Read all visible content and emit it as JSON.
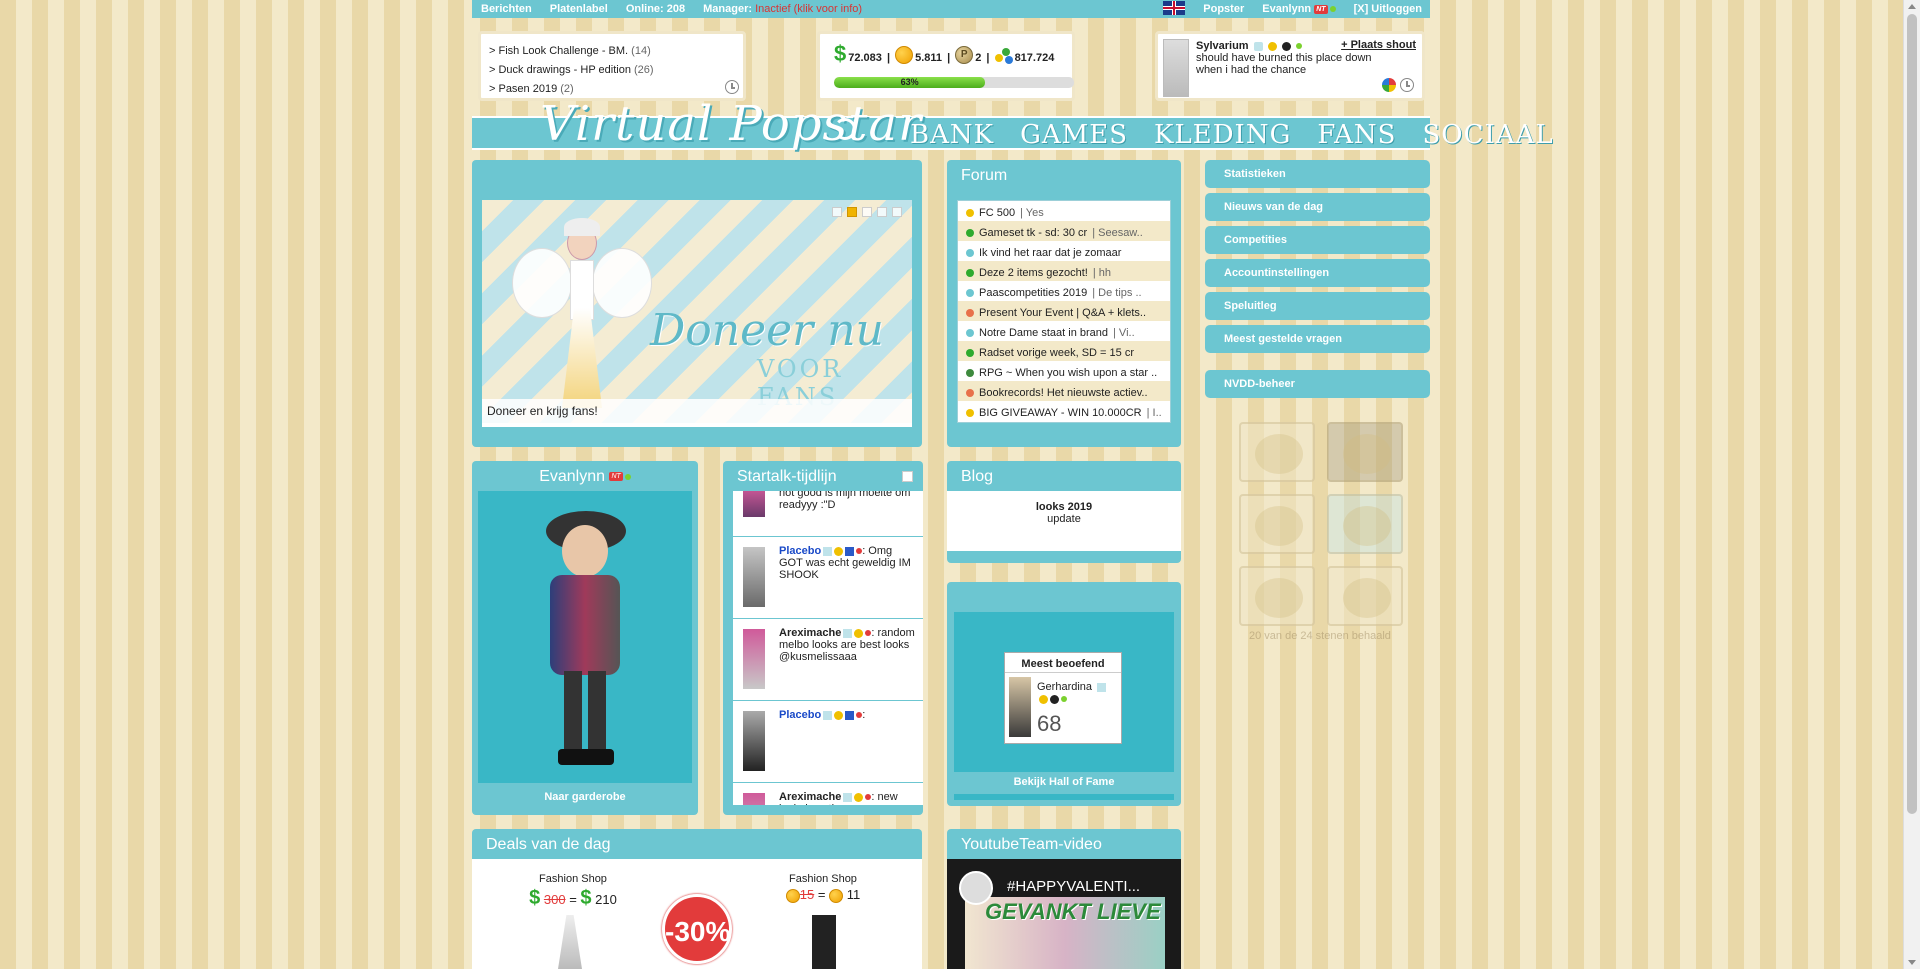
{
  "topbar": {
    "berichten": "Berichten",
    "platenlabel": "Platenlabel",
    "online": "Online: 208",
    "manager_label": "Manager:",
    "manager_status": "Inactief (klik voor info)",
    "popster": "Popster",
    "user": "Evanlynn",
    "logout": "[X] Uitloggen"
  },
  "contests": [
    {
      "label": "> Fish Look Challenge - BM.",
      "count": "(14)"
    },
    {
      "label": "> Duck drawings - HP edition",
      "count": "(26)"
    },
    {
      "label": "> Pasen 2019",
      "count": "(2)"
    }
  ],
  "money": {
    "dollars": "72.083",
    "coins": "5.811",
    "p": "2",
    "fans": "817.724",
    "progress_pct": 63,
    "progress_label": "63%"
  },
  "shout": {
    "name": "Sylvarium",
    "text": "should have burned this place down when i had the chance",
    "place_link": "+ Plaats shout"
  },
  "nav": {
    "logo": "Virtual Popstar",
    "items": [
      "BANK",
      "GAMES",
      "KLEDING",
      "FANS",
      "SOCIAAL"
    ]
  },
  "banner": {
    "headline": "Doneer nu",
    "sub": "VOOR FANS",
    "caption": "Doneer en krijg fans!"
  },
  "forum": {
    "title": "Forum",
    "items": [
      {
        "title": "FC 500",
        "extra": "| Yes",
        "color": "#f0c000"
      },
      {
        "title": "Gameset tk - sd: 30 cr",
        "extra": "| Seesaw..",
        "color": "#2eaa2e"
      },
      {
        "title": "Ik vind het raar dat je zomaar",
        "extra": "",
        "color": "#6cc6d1"
      },
      {
        "title": "Deze 2 items gezocht!",
        "extra": "| hh",
        "color": "#2eaa2e"
      },
      {
        "title": "Paascompetities 2019",
        "extra": "| De tips ..",
        "color": "#6cc6d1"
      },
      {
        "title": "Present Your Event | Q&A + klets..",
        "extra": "",
        "color": "#e8704a"
      },
      {
        "title": "Notre Dame staat in brand",
        "extra": "| Vi..",
        "color": "#6cc6d1"
      },
      {
        "title": "Radset vorige week, SD = 15 cr",
        "extra": "",
        "color": "#2eaa2e"
      },
      {
        "title": "RPG ~ When you wish upon a star ..",
        "extra": "",
        "color": "#3e8a3e"
      },
      {
        "title": "Bookrecords! Het nieuwste actiev..",
        "extra": "",
        "color": "#e8704a"
      },
      {
        "title": "BIG GIVEAWAY - WIN 10.000CR",
        "extra": "| I..",
        "color": "#f0c000"
      }
    ]
  },
  "menu": [
    "Statistieken",
    "Nieuws van de dag",
    "Competities",
    "Accountinstellingen",
    "Speluitleg",
    "Meest gestelde vragen",
    "NVDD-beheer"
  ],
  "badges_note": "20 van de 24 stenen behaald",
  "profile": {
    "name": "Evanlynn",
    "link": "Naar garderobe"
  },
  "startalk": {
    "title": "Startalk-tijdlijn",
    "items": [
      {
        "name": "",
        "text": "not good is mijn moeite om readyyy :\"D",
        "blue": false
      },
      {
        "name": "Placebo",
        "text": ": Omg GOT was echt geweldig IM SHOOK",
        "blue": true
      },
      {
        "name": "Areximache",
        "text": ": random melbo looks are best looks @kusmelissaaa",
        "blue": false
      },
      {
        "name": "Placebo",
        "text": ":",
        "blue": true
      },
      {
        "name": "Areximache",
        "text": ": new look, love these",
        "blue": false
      }
    ]
  },
  "blog": {
    "title": "Blog",
    "entry_title": "looks 2019",
    "entry_sub": "update"
  },
  "hof": {
    "card_title": "Meest beoefend",
    "name": "Gerhardina",
    "score": "68",
    "link": "Bekijk Hall of Fame"
  },
  "deals": {
    "title": "Deals van de dag",
    "items": [
      {
        "shop": "Fashion Shop",
        "old": "300",
        "new": "210",
        "currency": "dollar"
      },
      {
        "shop": "Fashion Shop",
        "old": "15",
        "new": "11",
        "currency": "coin"
      }
    ],
    "sale": "-30%"
  },
  "youtube": {
    "title": "YoutubeTeam-video",
    "video_title": "#HAPPYVALENTI...",
    "thumb_text": "GEVANKT LIEVE"
  }
}
